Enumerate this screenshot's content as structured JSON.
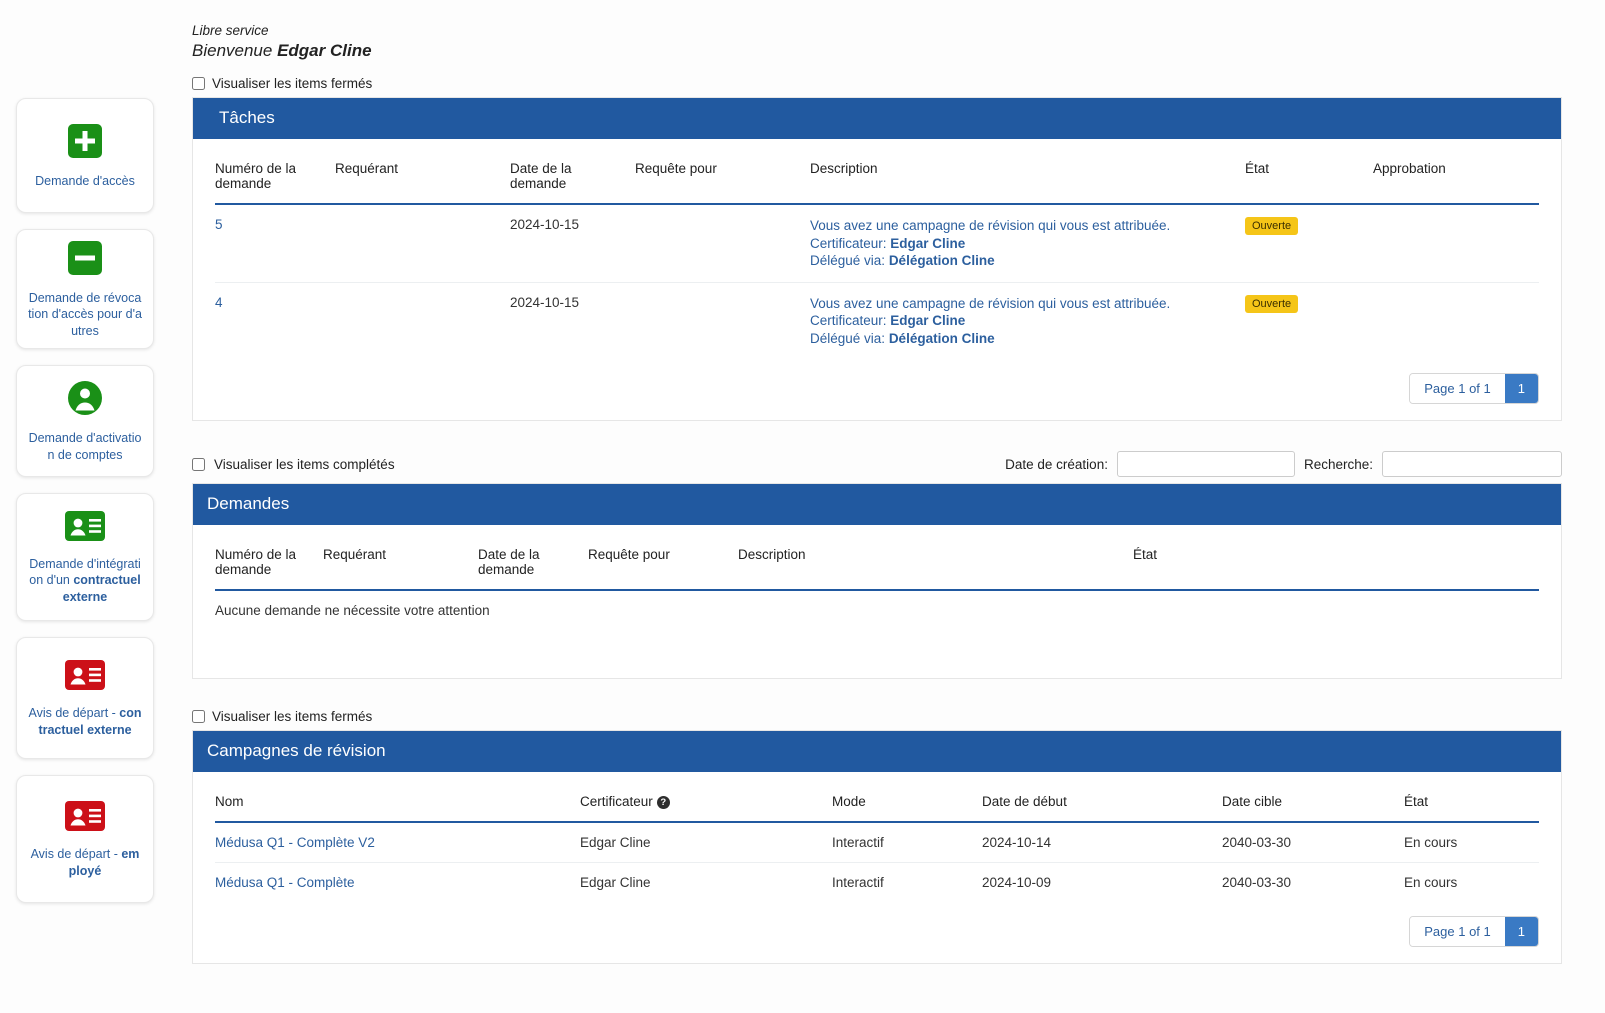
{
  "header": {
    "line1": "Libre service",
    "welcome_prefix": "Bienvenue ",
    "user_name": "Edgar Cline"
  },
  "colors": {
    "panel_blue": "#2159a0",
    "link_blue": "#2c5f9e",
    "badge_amber": "#f5c518",
    "icon_green": "#1a9017",
    "icon_red": "#cc1018"
  },
  "sidebar": {
    "items": [
      {
        "label_plain": "Demande d'accès",
        "label_bold": "",
        "icon": "plus-square-icon",
        "color": "#1a9017"
      },
      {
        "label_plain": "Demande de révocation d'accès pour d'autres",
        "label_bold": "",
        "icon": "minus-square-icon",
        "color": "#1a9017"
      },
      {
        "label_plain": "Demande d'activation de comptes",
        "label_bold": "",
        "icon": "person-circle-icon",
        "color": "#1a9017"
      },
      {
        "label_plain": "Demande d'intégration d'un ",
        "label_bold": "contractuel externe",
        "icon": "id-card-icon",
        "color": "#1a9017"
      },
      {
        "label_plain": "Avis de départ - ",
        "label_bold": "contractuel externe",
        "icon": "id-card-icon",
        "color": "#cc1018"
      },
      {
        "label_plain": "Avis de départ - ",
        "label_bold": "employé",
        "icon": "id-card-icon",
        "color": "#cc1018"
      }
    ]
  },
  "tasks": {
    "checkbox_label": "Visualiser les items fermés",
    "panel_title": "Tâches",
    "columns": [
      "Numéro de la demande",
      "Requérant",
      "Date de la demande",
      "Requête pour",
      "Description",
      "État",
      "Approbation"
    ],
    "rows": [
      {
        "id": "5",
        "requerant": "",
        "date": "2024-10-15",
        "requete_pour": "",
        "desc_main": "Vous avez une campagne de révision qui vous est attribuée.",
        "desc_cert_label": "Certificateur: ",
        "desc_cert_value": "Edgar Cline",
        "desc_deleg_label": "Délégué via: ",
        "desc_deleg_value": "Délégation Cline",
        "etat": "Ouverte",
        "approbation": ""
      },
      {
        "id": "4",
        "requerant": "",
        "date": "2024-10-15",
        "requete_pour": "",
        "desc_main": "Vous avez une campagne de révision qui vous est attribuée.",
        "desc_cert_label": "Certificateur: ",
        "desc_cert_value": "Edgar Cline",
        "desc_deleg_label": "Délégué via: ",
        "desc_deleg_value": "Délégation Cline",
        "etat": "Ouverte",
        "approbation": ""
      }
    ],
    "pager": {
      "label": "Page 1 of 1",
      "current": "1"
    }
  },
  "requests": {
    "checkbox_label": "Visualiser les items complétés",
    "date_filter_label": "Date de création:",
    "date_filter_value": "",
    "date_filter_placeholder": "",
    "search_label": "Recherche:",
    "search_value": "",
    "search_placeholder": "",
    "panel_title": "Demandes",
    "columns": [
      "Numéro de la demande",
      "Requérant",
      "Date de la demande",
      "Requête pour",
      "Description",
      "État"
    ],
    "empty_message": "Aucune demande ne nécessite votre attention"
  },
  "campaigns": {
    "checkbox_label": "Visualiser les items fermés",
    "panel_title": "Campagnes de révision",
    "columns": [
      "Nom",
      "Certificateur",
      "Mode",
      "Date de début",
      "Date cible",
      "État"
    ],
    "certificateur_help": "?",
    "rows": [
      {
        "nom": "Médusa Q1 - Complète V2",
        "certificateur": "Edgar Cline",
        "mode": "Interactif",
        "date_debut": "2024-10-14",
        "date_cible": "2040-03-30",
        "etat": "En cours"
      },
      {
        "nom": "Médusa Q1 - Complète",
        "certificateur": "Edgar Cline",
        "mode": "Interactif",
        "date_debut": "2024-10-09",
        "date_cible": "2040-03-30",
        "etat": "En cours"
      }
    ],
    "pager": {
      "label": "Page 1 of 1",
      "current": "1"
    }
  }
}
